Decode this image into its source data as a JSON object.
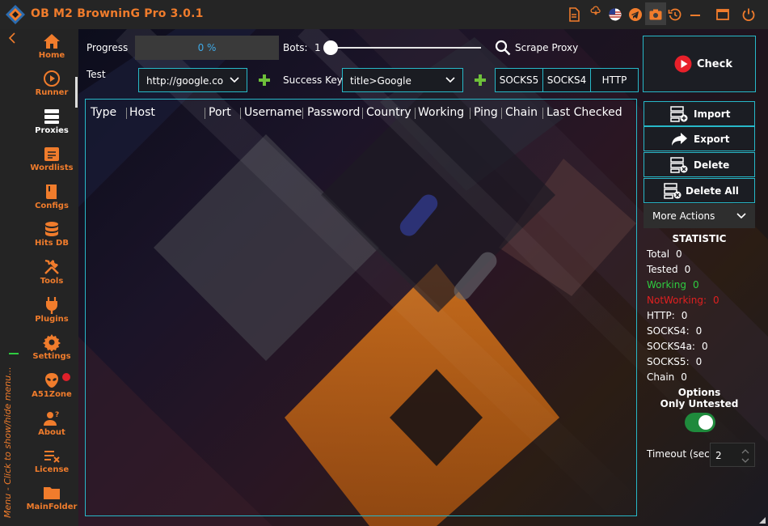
{
  "app": {
    "title": "OB M2 BrowninG Pro  3.0.1"
  },
  "sidebar": {
    "menu_hint": "Menu - Click to show/hide menu...",
    "items": [
      {
        "label": "Home",
        "icon": "home-icon"
      },
      {
        "label": "Runner",
        "icon": "play-icon"
      },
      {
        "label": "Proxies",
        "icon": "server-icon"
      },
      {
        "label": "Wordlists",
        "icon": "wordlist-icon"
      },
      {
        "label": "Configs",
        "icon": "book-icon"
      },
      {
        "label": "Hits DB",
        "icon": "database-icon"
      },
      {
        "label": "Tools",
        "icon": "tools-icon"
      },
      {
        "label": "Plugins",
        "icon": "plug-icon"
      },
      {
        "label": "Settings",
        "icon": "gear-icon"
      },
      {
        "label": "A51Zone",
        "icon": "alien-icon"
      },
      {
        "label": "About",
        "icon": "user-question-icon"
      },
      {
        "label": "License",
        "icon": "license-icon"
      },
      {
        "label": "MainFolder",
        "icon": "folder-icon"
      }
    ]
  },
  "toolbar": {
    "progress_label": "Progress",
    "progress_value": "0 %",
    "bots_label": "Bots:",
    "bots_value": "1",
    "scrape_label": "Scrape Proxy",
    "test_label": "Test",
    "test_url": "http://google.co",
    "success_key_label": "Success Key",
    "success_key_value": "title>Google",
    "proxy_types": [
      "SOCKS5",
      "SOCKS4",
      "HTTP"
    ]
  },
  "table": {
    "columns": [
      "Type",
      "Host",
      "Port",
      "Username",
      "Password",
      "Country",
      "Working",
      "Ping",
      "Chain",
      "Last Checked"
    ]
  },
  "actions": {
    "check": "Check",
    "import": "Import",
    "export": "Export",
    "delete": "Delete",
    "delete_all": "Delete All",
    "more_actions": "More Actions"
  },
  "statistic": {
    "title": "STATISTIC",
    "rows": [
      {
        "label": "Total",
        "value": "0",
        "color": "#ffffff"
      },
      {
        "label": "Tested",
        "value": "0",
        "color": "#ffffff"
      },
      {
        "label": "Working",
        "value": "0",
        "color": "#2ecc40"
      },
      {
        "label": "NotWorking:",
        "value": "0",
        "color": "#e02020"
      },
      {
        "label": "HTTP:",
        "value": "0",
        "color": "#ffffff"
      },
      {
        "label": "SOCKS4:",
        "value": "0",
        "color": "#ffffff"
      },
      {
        "label": "SOCKS4a:",
        "value": "0",
        "color": "#ffffff"
      },
      {
        "label": "SOCKS5:",
        "value": "0",
        "color": "#ffffff"
      },
      {
        "label": "Chain",
        "value": "0",
        "color": "#ffffff"
      }
    ]
  },
  "options": {
    "title_line1": "Options",
    "title_line2": "Only Untested",
    "only_untested": true,
    "timeout_label": "Timeout (sec):",
    "timeout_value": "2"
  },
  "colors": {
    "accent": "#f07c2c",
    "teal": "#27b8c8",
    "success": "#2ecc40",
    "danger": "#e02020"
  }
}
